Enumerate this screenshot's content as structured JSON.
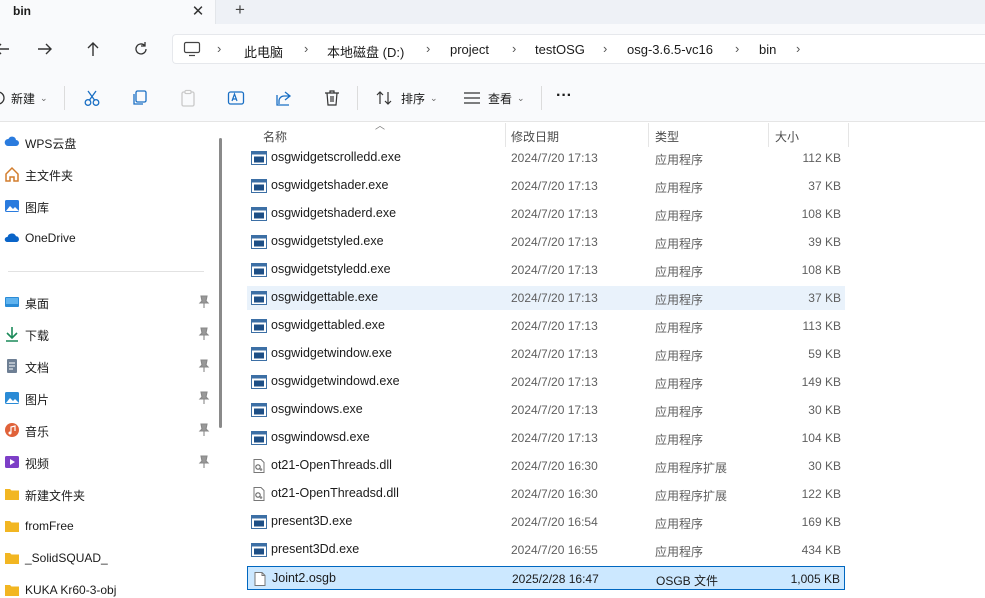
{
  "tab": {
    "title": "bin",
    "close": "✕",
    "new": "+"
  },
  "nav": {
    "breadcrumb": [
      "此电脑",
      "本地磁盘 (D:)",
      "project",
      "testOSG",
      "osg-3.6.5-vc16",
      "bin"
    ]
  },
  "toolbar": {
    "new_label": "新建",
    "sort_label": "排序",
    "view_label": "查看",
    "more": "···"
  },
  "sidebar": {
    "top_items": [
      {
        "label": "WPS云盘",
        "icon": "cloud-icon"
      },
      {
        "label": "主文件夹",
        "icon": "home-icon"
      },
      {
        "label": "图库",
        "icon": "gallery-icon"
      },
      {
        "label": "OneDrive",
        "icon": "onedrive-icon"
      }
    ],
    "pinned_items": [
      {
        "label": "桌面",
        "icon": "desktop-icon"
      },
      {
        "label": "下载",
        "icon": "download-icon"
      },
      {
        "label": "文档",
        "icon": "document-icon"
      },
      {
        "label": "图片",
        "icon": "pictures-icon"
      },
      {
        "label": "音乐",
        "icon": "music-icon"
      },
      {
        "label": "视频",
        "icon": "video-icon"
      }
    ],
    "folders": [
      {
        "label": "新建文件夹"
      },
      {
        "label": "fromFree"
      },
      {
        "label": "_SolidSQUAD_"
      },
      {
        "label": "KUKA Kr60-3-obj"
      }
    ]
  },
  "columns": {
    "name": "名称",
    "date": "修改日期",
    "type": "类型",
    "size": "大小"
  },
  "files": [
    {
      "name": "osgwidgetscrolledd.exe",
      "date": "2024/7/20 17:13",
      "type": "应用程序",
      "size": "112 KB",
      "kind": "exe"
    },
    {
      "name": "osgwidgetshader.exe",
      "date": "2024/7/20 17:13",
      "type": "应用程序",
      "size": "37 KB",
      "kind": "exe"
    },
    {
      "name": "osgwidgetshaderd.exe",
      "date": "2024/7/20 17:13",
      "type": "应用程序",
      "size": "108 KB",
      "kind": "exe"
    },
    {
      "name": "osgwidgetstyled.exe",
      "date": "2024/7/20 17:13",
      "type": "应用程序",
      "size": "39 KB",
      "kind": "exe"
    },
    {
      "name": "osgwidgetstyledd.exe",
      "date": "2024/7/20 17:13",
      "type": "应用程序",
      "size": "108 KB",
      "kind": "exe"
    },
    {
      "name": "osgwidgettable.exe",
      "date": "2024/7/20 17:13",
      "type": "应用程序",
      "size": "37 KB",
      "kind": "exe"
    },
    {
      "name": "osgwidgettabled.exe",
      "date": "2024/7/20 17:13",
      "type": "应用程序",
      "size": "113 KB",
      "kind": "exe"
    },
    {
      "name": "osgwidgetwindow.exe",
      "date": "2024/7/20 17:13",
      "type": "应用程序",
      "size": "59 KB",
      "kind": "exe"
    },
    {
      "name": "osgwidgetwindowd.exe",
      "date": "2024/7/20 17:13",
      "type": "应用程序",
      "size": "149 KB",
      "kind": "exe"
    },
    {
      "name": "osgwindows.exe",
      "date": "2024/7/20 17:13",
      "type": "应用程序",
      "size": "30 KB",
      "kind": "exe"
    },
    {
      "name": "osgwindowsd.exe",
      "date": "2024/7/20 17:13",
      "type": "应用程序",
      "size": "104 KB",
      "kind": "exe"
    },
    {
      "name": "ot21-OpenThreads.dll",
      "date": "2024/7/20 16:30",
      "type": "应用程序扩展",
      "size": "30 KB",
      "kind": "dll"
    },
    {
      "name": "ot21-OpenThreadsd.dll",
      "date": "2024/7/20 16:30",
      "type": "应用程序扩展",
      "size": "122 KB",
      "kind": "dll"
    },
    {
      "name": "present3D.exe",
      "date": "2024/7/20 16:54",
      "type": "应用程序",
      "size": "169 KB",
      "kind": "exe"
    },
    {
      "name": "present3Dd.exe",
      "date": "2024/7/20 16:55",
      "type": "应用程序",
      "size": "434 KB",
      "kind": "exe"
    },
    {
      "name": "Joint2.osgb",
      "date": "2025/2/28 16:47",
      "type": "OSGB 文件",
      "size": "1,005 KB",
      "kind": "file"
    }
  ],
  "state": {
    "hover_row": 5,
    "selected_row": 15
  }
}
